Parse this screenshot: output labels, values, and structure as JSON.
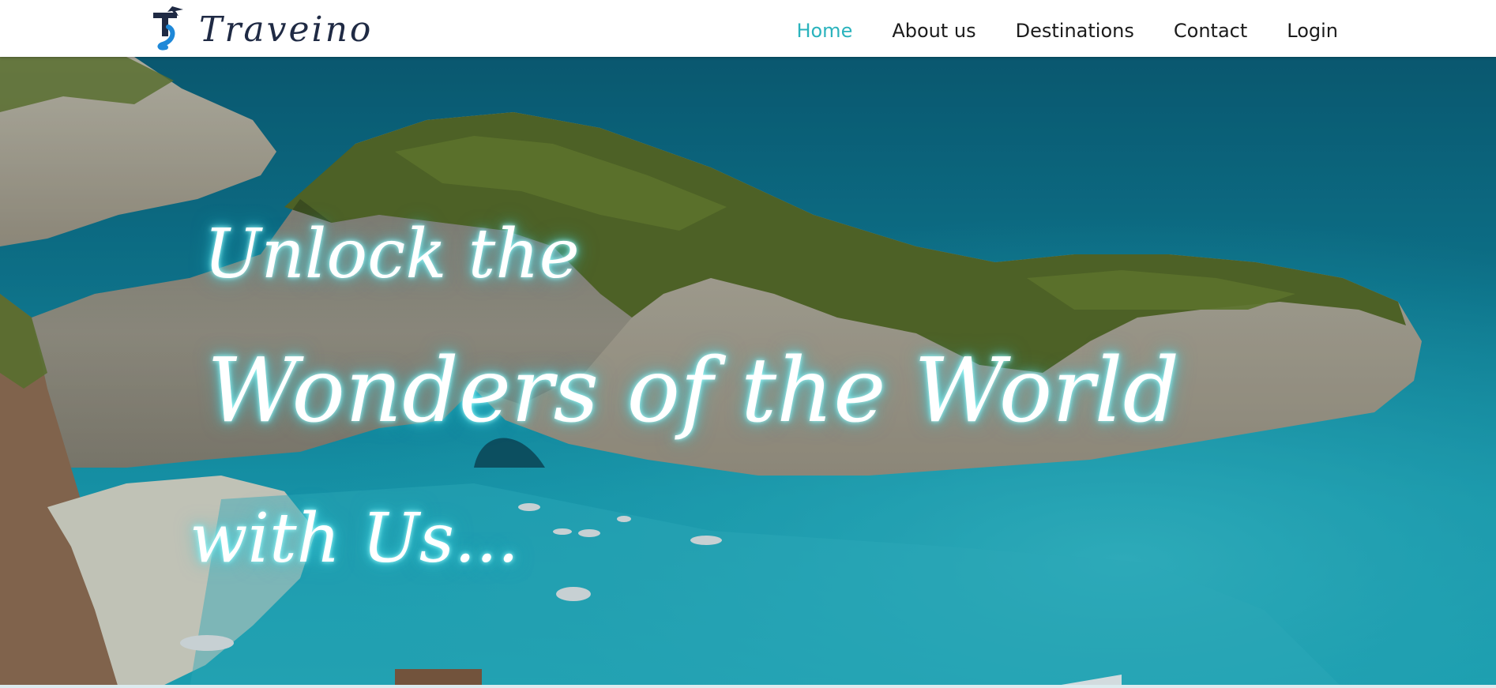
{
  "brand": {
    "name": "Traveino",
    "logo_icon": "plane-t-logo-icon"
  },
  "nav": {
    "items": [
      {
        "label": "Home",
        "active": true
      },
      {
        "label": "About us",
        "active": false
      },
      {
        "label": "Destinations",
        "active": false
      },
      {
        "label": "Contact",
        "active": false
      },
      {
        "label": "Login",
        "active": false
      }
    ]
  },
  "hero": {
    "line1": "Unlock the",
    "line2": "Wonders of the World",
    "line3": "with Us..."
  },
  "colors": {
    "accent": "#2ab3bd",
    "nav_text": "#1b1b1b",
    "brand_text": "#1f2a44",
    "sea_deep": "#0b5f78",
    "sea_turquoise": "#1fb3c5",
    "vegetation": "#5d6b1f",
    "cliff": "#c9b9a3"
  }
}
